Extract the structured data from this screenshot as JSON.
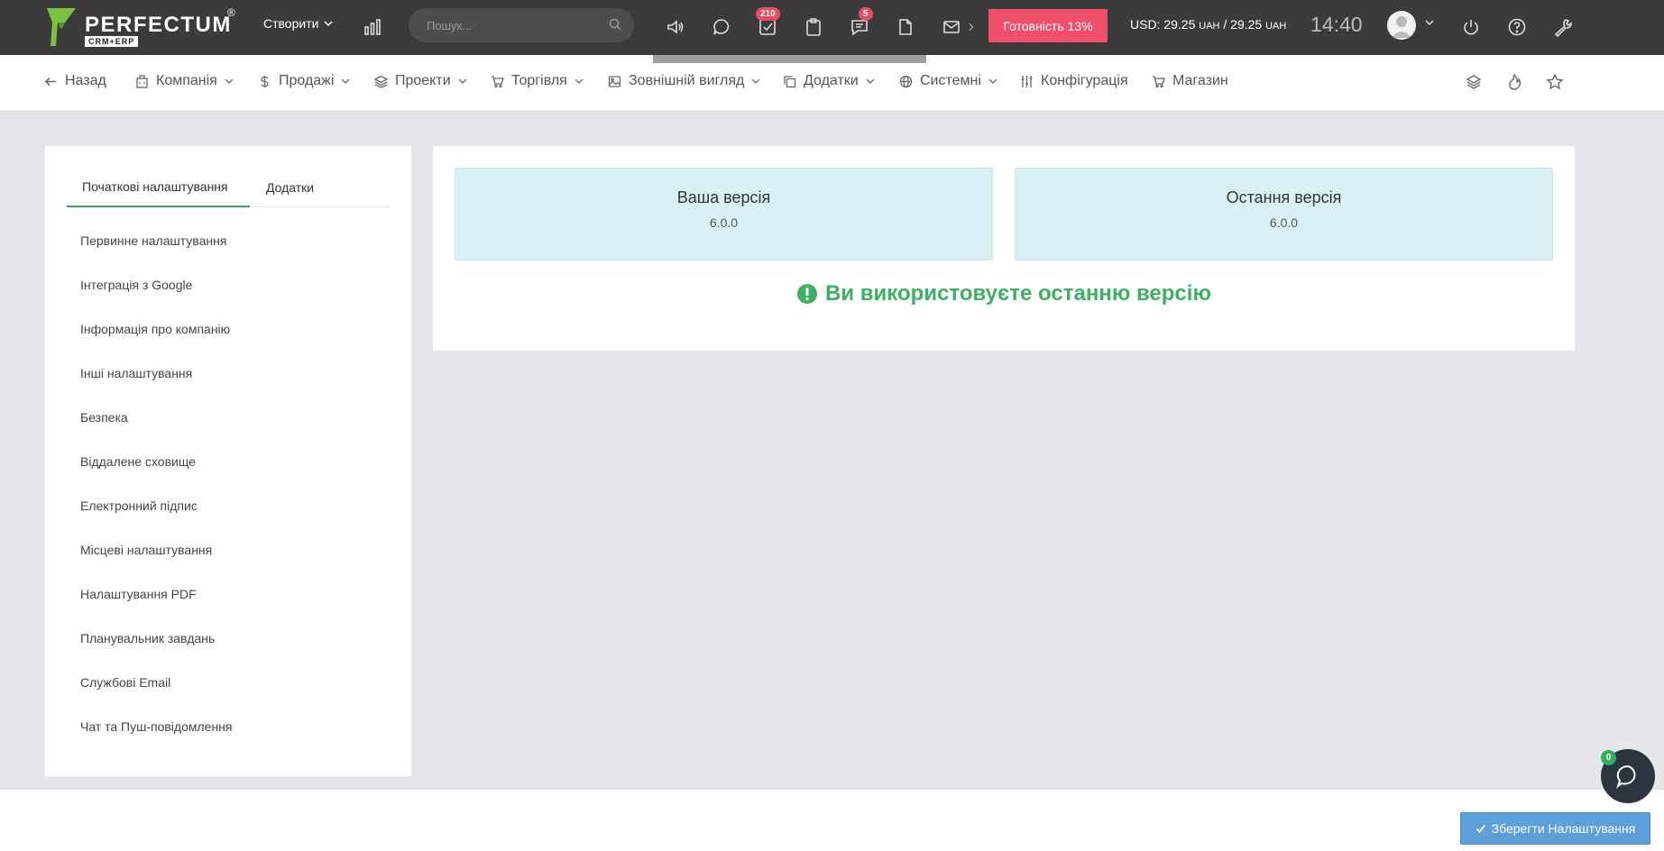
{
  "topbar": {
    "logo_text": "PERFECTUM",
    "logo_reg": "®",
    "logo_sub": "CRM+ERP",
    "create_label": "Створити",
    "search_placeholder": "Пошук...",
    "tasks_badge": "210",
    "messages_badge": "5",
    "readiness_label": "Готовність 13%",
    "currency_prefix": "USD: 29.25",
    "currency_unit": "UAH",
    "currency_sep": " / 29.25",
    "clock": "14:40",
    "icons": [
      "chart-bar-icon",
      "megaphone-icon",
      "chat-bubble-icon",
      "tasks-check-icon",
      "clipboard-icon",
      "messages-icon",
      "file-icon",
      "mail-icon",
      "power-icon",
      "help-icon",
      "wrench-icon"
    ]
  },
  "nav": {
    "back": "Назад",
    "company": "Компанія",
    "sales": "Продажі",
    "projects": "Проекти",
    "trade": "Торгівля",
    "appearance": "Зовнішній вигляд",
    "addons": "Додатки",
    "system": "Системні",
    "config": "Конфігурація",
    "shop": "Магазин"
  },
  "sidebar": {
    "tab_initial": "Початкові налаштування",
    "tab_addons": "Додатки",
    "items": [
      "Первинне налаштування",
      "Інтеграція з Google",
      "Інформація про компанію",
      "Інші налаштування",
      "Безпека",
      "Віддалене сховище",
      "Електронний підпис",
      "Місцеві налаштування",
      "Налаштування PDF",
      "Планувальник завдань",
      "Службові Email",
      "Чат та Пуш-повідомлення"
    ]
  },
  "main": {
    "your_version_title": "Ваша версія",
    "your_version": "6.0.0",
    "latest_version_title": "Остання версія",
    "latest_version": "6.0.0",
    "status_message": "Ви використовуєте останню версію"
  },
  "footer": {
    "save_label": "Зберегти Налаштування",
    "chat_badge": "0"
  },
  "colors": {
    "topbar": "#3b3b3b",
    "accent_green": "#3eb063",
    "readiness_red": "#ef4f6a",
    "save_blue": "#5d9fd9",
    "version_box": "#daf0f7"
  }
}
